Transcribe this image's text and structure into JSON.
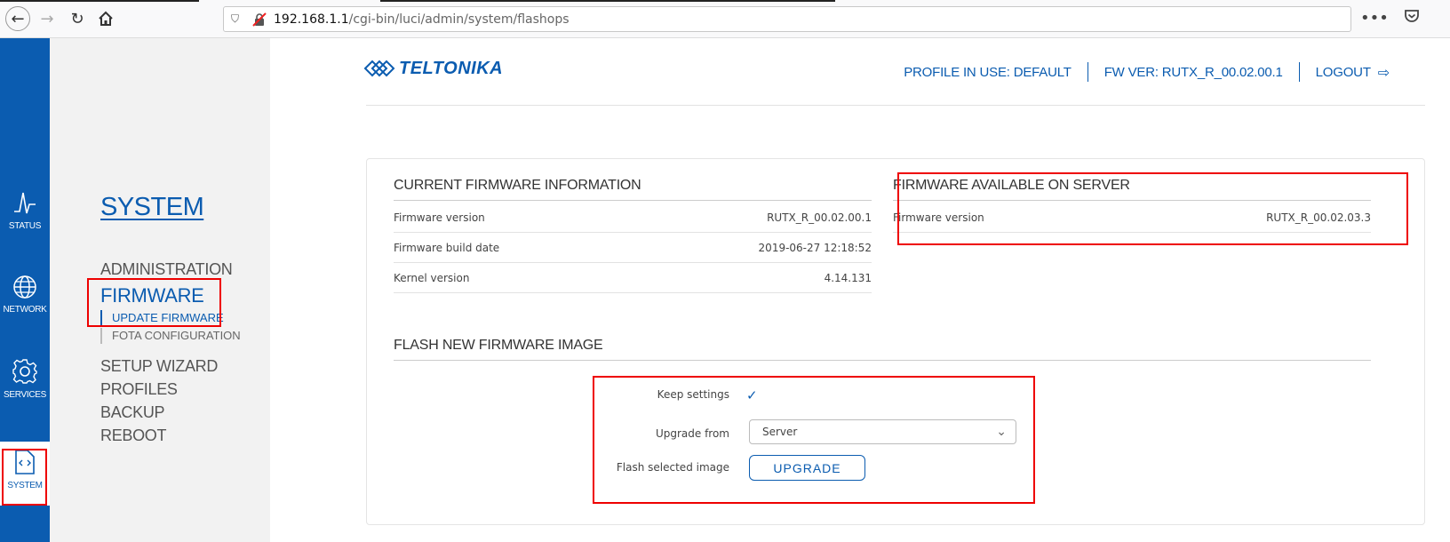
{
  "browser": {
    "url_host": "192.168.1.1",
    "url_path": "/cgi-bin/luci/admin/system/flashops",
    "menu_glyph": "•••"
  },
  "rail": {
    "items": [
      {
        "label": "STATUS"
      },
      {
        "label": "NETWORK"
      },
      {
        "label": "SERVICES"
      },
      {
        "label": "SYSTEM"
      }
    ]
  },
  "submenu": {
    "title": "SYSTEM",
    "items": {
      "administration": "ADMINISTRATION",
      "firmware": "FIRMWARE",
      "update_firmware": "UPDATE FIRMWARE",
      "fota_configuration": "FOTA CONFIGURATION",
      "setup_wizard": "SETUP WIZARD",
      "profiles": "PROFILES",
      "backup": "BACKUP",
      "reboot": "REBOOT"
    }
  },
  "header": {
    "logo_text": "TELTONIKA",
    "profile": "PROFILE IN USE: DEFAULT",
    "fw_ver": "FW VER: RUTX_R_00.02.00.1",
    "logout": "LOGOUT"
  },
  "current_fw": {
    "title": "CURRENT FIRMWARE INFORMATION",
    "rows": [
      {
        "label": "Firmware version",
        "value": "RUTX_R_00.02.00.1"
      },
      {
        "label": "Firmware build date",
        "value": "2019-06-27 12:18:52"
      },
      {
        "label": "Kernel version",
        "value": "4.14.131"
      }
    ]
  },
  "server_fw": {
    "title": "FIRMWARE AVAILABLE ON SERVER",
    "rows": [
      {
        "label": "Firmware version",
        "value": "RUTX_R_00.02.03.3"
      }
    ]
  },
  "flash": {
    "title": "FLASH NEW FIRMWARE IMAGE",
    "keep_settings_label": "Keep settings",
    "keep_settings_checked": true,
    "upgrade_from_label": "Upgrade from",
    "upgrade_from_value": "Server",
    "flash_selected_label": "Flash selected image",
    "upgrade_button": "UPGRADE"
  },
  "colors": {
    "brand_blue": "#0b5cb0",
    "highlight_red": "#ee0000"
  }
}
